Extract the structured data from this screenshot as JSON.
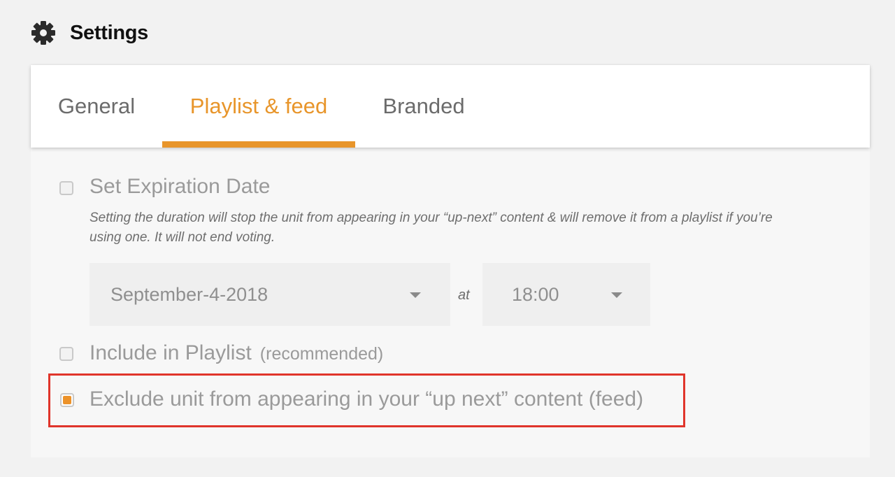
{
  "header": {
    "icon": "gear-icon",
    "title": "Settings"
  },
  "tabs": [
    {
      "label": "General",
      "active": false
    },
    {
      "label": "Playlist & feed",
      "active": true
    },
    {
      "label": "Branded",
      "active": false
    }
  ],
  "accent_color": "#e8952a",
  "highlight_color": "#e0352b",
  "expiration": {
    "label": "Set Expiration Date",
    "checked": false,
    "help_text": "Setting the duration will stop the unit from appearing in your “up-next” content & will remove it from a playlist if you’re using one. It will not end voting.",
    "date_value": "September-4-2018",
    "at_label": "at",
    "time_value": "18:00"
  },
  "include_playlist": {
    "label": "Include in Playlist",
    "sub_label": "(recommended)",
    "checked": false
  },
  "exclude_feed": {
    "label": "Exclude unit from appearing in your “up next” content (feed)",
    "checked": true
  }
}
